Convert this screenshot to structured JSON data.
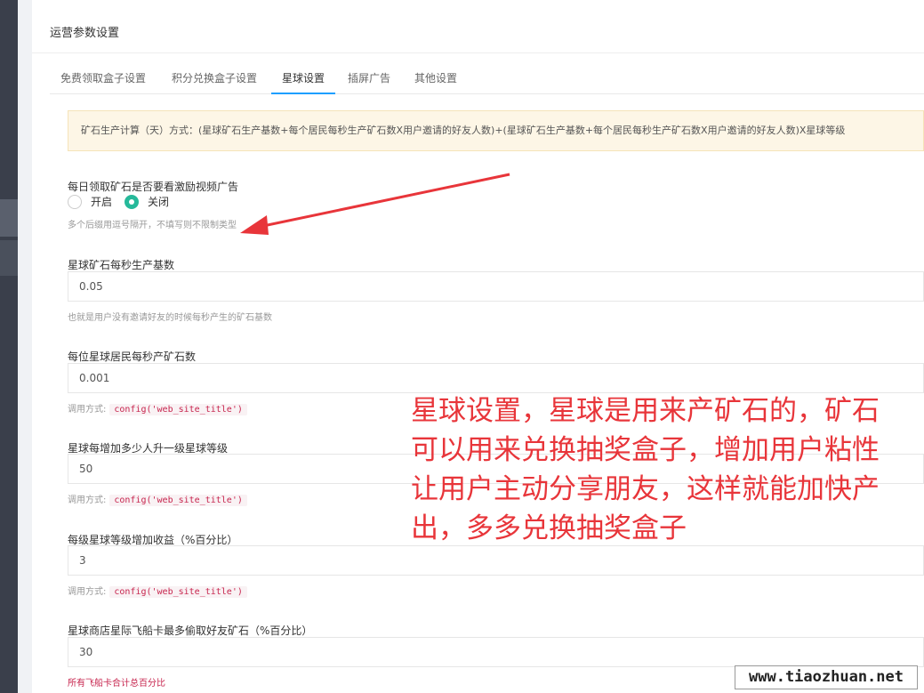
{
  "panel": {
    "title": "运营参数设置"
  },
  "tabs": [
    {
      "label": "免费领取盒子设置",
      "active": false
    },
    {
      "label": "积分兑换盒子设置",
      "active": false
    },
    {
      "label": "星球设置",
      "active": true
    },
    {
      "label": "插屏广告",
      "active": false
    },
    {
      "label": "其他设置",
      "active": false
    }
  ],
  "notice": {
    "text": "矿石生产计算（天）方式：(星球矿石生产基数+每个居民每秒生产矿石数X用户邀请的好友人数)+(星球矿石生产基数+每个居民每秒生产矿石数X用户邀请的好友人数)X星球等级"
  },
  "ad_toggle": {
    "label": "每日领取矿石是否要看激励视频广告",
    "options": [
      "开启",
      "关闭"
    ],
    "selected": "关闭",
    "help": "多个后缀用逗号隔开，不填写则不限制类型"
  },
  "fields": [
    {
      "label": "星球矿石每秒生产基数",
      "value": "0.05",
      "help": "也就是用户没有邀请好友的时候每秒产生的矿石基数"
    },
    {
      "label": "每位星球居民每秒产矿石数",
      "value": "0.001",
      "help_prefix": "调用方式:",
      "help_code": "config('web_site_title')"
    },
    {
      "label": "星球每增加多少人升一级星球等级",
      "value": "50",
      "help_prefix": "调用方式:",
      "help_code": "config('web_site_title')"
    },
    {
      "label": "每级星球等级增加收益（%百分比）",
      "value": "3",
      "help_prefix": "调用方式:",
      "help_code": "config('web_site_title')"
    },
    {
      "label": "星球商店星际飞船卡最多偷取好友矿石（%百分比）",
      "value": "30",
      "help": "所有飞船卡合计总百分比"
    }
  ],
  "annotation": {
    "lines": [
      "星球设置，星球是用来产矿石的，矿石",
      "可以用来兑换抽奖盒子，增加用户粘性",
      "让用户主动分享朋友，这样就能加快产",
      "出，多多兑换抽奖盒子"
    ],
    "color": "#e8353a"
  },
  "watermark": {
    "text": "www.tiaozhuan.net"
  },
  "colors": {
    "accent": "#1e9fff",
    "radio": "#26b99a",
    "notice_bg": "#fdf6e6"
  }
}
